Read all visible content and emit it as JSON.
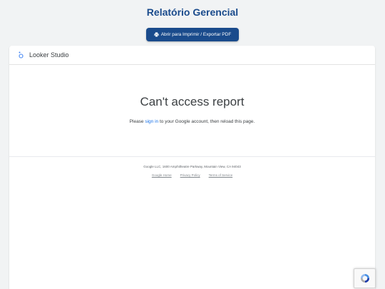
{
  "header": {
    "title": "Relatório Gerencial",
    "print_button_label": "Abrir para Imprimir / Exportar PDF",
    "print_icon": "printer-icon"
  },
  "embed": {
    "brand_name": "Looker Studio",
    "logo_icon": "looker-studio-logo-icon",
    "error_title": "Can't access report",
    "message_before": "Please ",
    "sign_in_link": "sign in",
    "message_after": " to your Google account, then reload this page."
  },
  "footer": {
    "address": "Google LLC, 1600 Amphitheatre Parkway, Mountain View, CA 94043",
    "links": [
      "Google Home",
      "Privacy Policy",
      "Terms of Service"
    ]
  },
  "widgets": {
    "recaptcha_icon": "recaptcha-icon"
  },
  "colors": {
    "title": "#1a4b8c",
    "button_bg": "#1a4b8c",
    "link": "#1a73e8",
    "logo": "#4285f4"
  }
}
